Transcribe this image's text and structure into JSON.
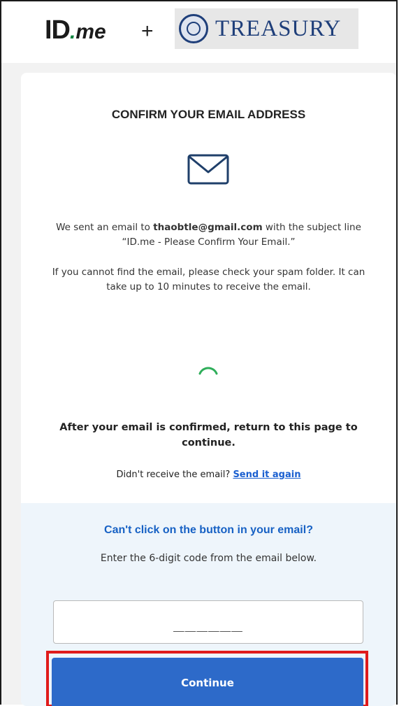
{
  "header": {
    "idme_logo_main": "ID",
    "idme_logo_dot": ".",
    "idme_logo_me": "me",
    "plus": "+",
    "treasury_logo": "TREASURY"
  },
  "card": {
    "title": "CONFIRM YOUR EMAIL ADDRESS",
    "icon": "envelope-icon",
    "sent_prefix": "We sent an email to ",
    "email": "thaobtle@gmail.com",
    "sent_suffix": " with the subject line “ID.me - Please Confirm Your Email.”",
    "spam_note": "If you cannot find the email, please check your spam folder. It can take up to 10 minutes to receive the email.",
    "spinner": "loading-spinner-icon",
    "after_confirm": "After your email is confirmed, return to this page to continue.",
    "resend_prefix": "Didn't receive the email? ",
    "resend_link": "Send it again"
  },
  "code_section": {
    "heading": "Can't click on the button in your email?",
    "instruction": "Enter the 6-digit code from the email below.",
    "input_value": "",
    "input_placeholder": "______",
    "continue_label": "Continue"
  },
  "colors": {
    "accent_blue": "#2d6ac9",
    "link_blue": "#1761c4",
    "spinner_green": "#2fae5a",
    "highlight_red": "#e01b1b",
    "panel_bg": "#eef5fb"
  }
}
